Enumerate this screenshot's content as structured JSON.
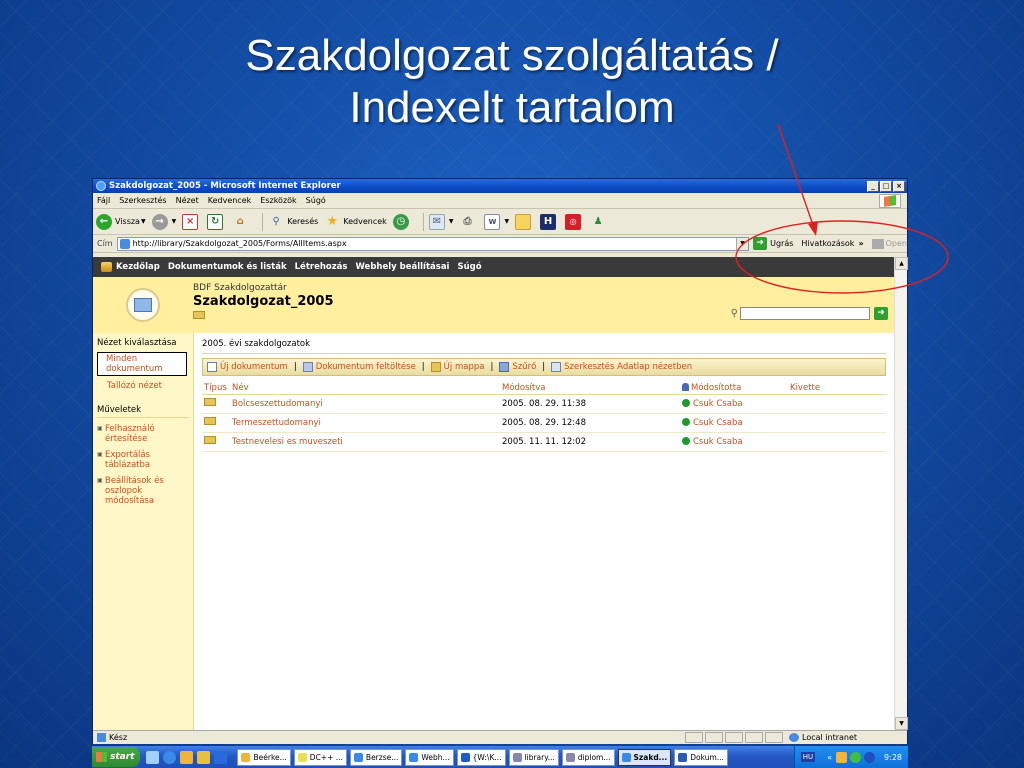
{
  "slide": {
    "title_line1": "Szakdolgozat szolgáltatás /",
    "title_line2": "Indexelt tartalom"
  },
  "window": {
    "title": "Szakdolgozat_2005 - Microsoft Internet Explorer",
    "controls": [
      "_",
      "□",
      "×"
    ]
  },
  "menubar": [
    "Fájl",
    "Szerkesztés",
    "Nézet",
    "Kedvencek",
    "Eszközök",
    "Súgó"
  ],
  "toolbar": {
    "back_label": "Vissza",
    "search_label": "Keresés",
    "favorites_label": "Kedvencek"
  },
  "addressbar": {
    "label": "Cím",
    "url": "http://library/Szakdolgozat_2005/Forms/AllItems.aspx",
    "go_label": "Ugrás",
    "links_label": "Hivatkozások",
    "open_label": "Open"
  },
  "sp_nav": [
    "Kezdőlap",
    "Dokumentumok és listák",
    "Létrehozás",
    "Webhely beállításai",
    "Súgó"
  ],
  "sp_header": {
    "site_name": "BDF Szakdolgozattár",
    "list_title": "Szakdolgozat_2005"
  },
  "left_nav": {
    "view_heading": "Nézet kiválasztása",
    "views": [
      "Minden dokumentum",
      "Tallózó nézet"
    ],
    "actions_heading": "Műveletek",
    "actions": [
      "Felhasználó értesítése",
      "Exportálás táblázatba",
      "Beállítások és oszlopok módosítása"
    ]
  },
  "main": {
    "view_title": "2005. évi szakdolgozatok",
    "actions": [
      "Új dokumentum",
      "Dokumentum feltöltése",
      "Új mappa",
      "Szűrő",
      "Szerkesztés Adatlap nézetben"
    ],
    "columns": [
      "Típus",
      "Név",
      "Módosítva",
      "Módosította",
      "Kivette"
    ],
    "rows": [
      {
        "name": "Bolcseszettudomanyi",
        "modified": "2005. 08. 29. 11:38",
        "modified_by": "Csuk Csaba",
        "checked_out": ""
      },
      {
        "name": "Termeszettudomanyi",
        "modified": "2005. 08. 29. 12:48",
        "modified_by": "Csuk Csaba",
        "checked_out": ""
      },
      {
        "name": "Testnevelesi es muveszeti",
        "modified": "2005. 11. 11. 12:02",
        "modified_by": "Csuk Csaba",
        "checked_out": ""
      }
    ]
  },
  "statusbar": {
    "status": "Kész",
    "zone": "Local intranet"
  },
  "taskbar": {
    "start_label": "start",
    "tasks": [
      "Beérke...",
      "DC++ ...",
      "Berzse...",
      "Webh...",
      "{W:\\K...",
      "library...",
      "diplom...",
      "Szakd...",
      "Dokum..."
    ],
    "active_task_index": 7,
    "language": "HU",
    "clock": "9:28"
  },
  "colors": {
    "slide_bg": "#134da5",
    "sp_header_bg": "#ffef9f",
    "sp_link": "#c8501a",
    "annotation": "#e02020"
  }
}
